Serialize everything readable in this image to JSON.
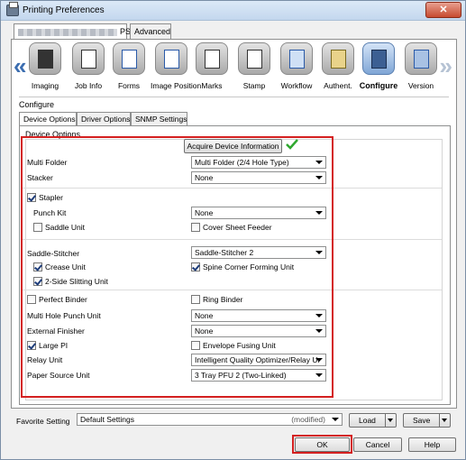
{
  "window": {
    "title": "Printing Preferences",
    "close_label": "✕"
  },
  "top_tabs": [
    {
      "label": "PS",
      "active": true
    },
    {
      "label": "Advanced",
      "active": false
    }
  ],
  "toolbar": {
    "items": [
      {
        "label": "Imaging",
        "icon": "imaging-icon",
        "selected": false
      },
      {
        "label": "Job Info",
        "icon": "job-info-icon",
        "selected": false
      },
      {
        "label": "Forms",
        "icon": "forms-icon",
        "selected": false
      },
      {
        "label": "Image Position",
        "icon": "image-position-icon",
        "selected": false
      },
      {
        "label": "Marks",
        "icon": "marks-icon",
        "selected": false
      },
      {
        "label": "Stamp",
        "icon": "stamp-icon",
        "selected": false
      },
      {
        "label": "Workflow",
        "icon": "workflow-icon",
        "selected": false
      },
      {
        "label": "Authent.",
        "icon": "authent-icon",
        "selected": false
      },
      {
        "label": "Configure",
        "icon": "configure-icon",
        "selected": true
      },
      {
        "label": "Version",
        "icon": "version-icon",
        "selected": false
      }
    ]
  },
  "configure": {
    "section_label": "Configure",
    "sub_tabs": [
      "Device Options",
      "Driver Options",
      "SNMP Settings"
    ],
    "group_title": "Device Options",
    "acquire_button": "Acquire Device Information",
    "fields": {
      "multi_folder": {
        "label": "Multi Folder",
        "value": "Multi Folder (2/4 Hole Type)"
      },
      "stacker": {
        "label": "Stacker",
        "value": "None"
      },
      "stapler": {
        "label": "Stapler",
        "checked": true
      },
      "punch_kit": {
        "label": "Punch Kit",
        "value": "None"
      },
      "saddle_unit": {
        "label": "Saddle Unit",
        "checked": false
      },
      "cover_sheet_feeder": {
        "label": "Cover Sheet Feeder",
        "checked": false
      },
      "saddle_stitcher": {
        "label": "Saddle-Stitcher",
        "value": "Saddle-Stitcher 2"
      },
      "crease_unit": {
        "label": "Crease Unit",
        "checked": true
      },
      "spine_corner": {
        "label": "Spine Corner Forming Unit",
        "checked": true
      },
      "two_side_slitting": {
        "label": "2-Side Slitting Unit",
        "checked": true
      },
      "perfect_binder": {
        "label": "Perfect Binder",
        "checked": false
      },
      "ring_binder": {
        "label": "Ring Binder",
        "checked": false
      },
      "multi_hole_punch": {
        "label": "Multi Hole Punch Unit",
        "value": "None"
      },
      "external_finisher": {
        "label": "External Finisher",
        "value": "None"
      },
      "large_pi": {
        "label": "Large PI",
        "checked": true
      },
      "envelope_fusing": {
        "label": "Envelope Fusing Unit",
        "checked": false
      },
      "relay_unit": {
        "label": "Relay Unit",
        "value": "Intelligent Quality Optimizer/Relay Ur"
      },
      "paper_source_unit": {
        "label": "Paper Source Unit",
        "value": "3 Tray PFU 2 (Two-Linked)"
      }
    }
  },
  "favorite": {
    "label": "Favorite Setting",
    "value": "Default Settings",
    "status": "(modified)",
    "load_label": "Load",
    "save_label": "Save"
  },
  "buttons": {
    "ok": "OK",
    "cancel": "Cancel",
    "help": "Help"
  },
  "colors": {
    "highlight": "#d42020",
    "selected_tool": "#7fa6d6",
    "check_green": "#2fa82f"
  }
}
